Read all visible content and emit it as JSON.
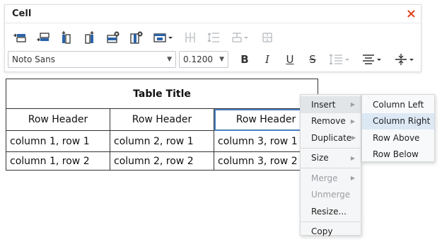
{
  "panel": {
    "title": "Cell",
    "close_symbol": "×"
  },
  "toolbar": {
    "row1_icons": [
      "insert-row-above-icon",
      "insert-row-below-icon",
      "insert-column-left-icon",
      "insert-column-right-icon",
      "delete-row-icon",
      "delete-column-icon",
      "table-options-icon",
      "distribute-columns-icon",
      "distribute-rows-icon",
      "merge-cells-icon",
      "split-cells-icon"
    ],
    "font_family": "Noto Sans",
    "font_size": "0.1200",
    "bold_label": "B",
    "italic_label": "I",
    "underline_label": "U",
    "strikethrough_label": "S"
  },
  "table": {
    "title": "Table Title",
    "headers": [
      "Row Header",
      "Row Header",
      "Row Header"
    ],
    "rows": [
      [
        "column 1, row 1",
        "column 2, row 1",
        "column 3, row 1"
      ],
      [
        "column 1, row 2",
        "column 2, row 2",
        "column 3, row 2"
      ]
    ]
  },
  "context_menu": {
    "items": [
      {
        "label": "Insert",
        "has_submenu": true,
        "disabled": false
      },
      {
        "label": "Remove",
        "has_submenu": true,
        "disabled": false
      },
      {
        "label": "Duplicate",
        "has_submenu": true,
        "disabled": false
      },
      {
        "label": "Size",
        "has_submenu": true,
        "disabled": false
      },
      {
        "label": "Merge",
        "has_submenu": true,
        "disabled": true
      },
      {
        "label": "Unmerge",
        "has_submenu": false,
        "disabled": true
      },
      {
        "label": "Resize...",
        "has_submenu": false,
        "disabled": false
      },
      {
        "label": "Copy",
        "has_submenu": false,
        "disabled": false
      }
    ],
    "submenu_items": [
      {
        "label": "Column Left",
        "highlighted": false
      },
      {
        "label": "Column Right",
        "highlighted": true
      },
      {
        "label": "Row Above",
        "highlighted": false
      },
      {
        "label": "Row Below",
        "highlighted": false
      }
    ]
  },
  "colors": {
    "close": "#e0451f",
    "selection_outline": "#4a7fc1",
    "submenu_highlight": "#dde8f5",
    "icon_blue": "#2b63a8"
  }
}
